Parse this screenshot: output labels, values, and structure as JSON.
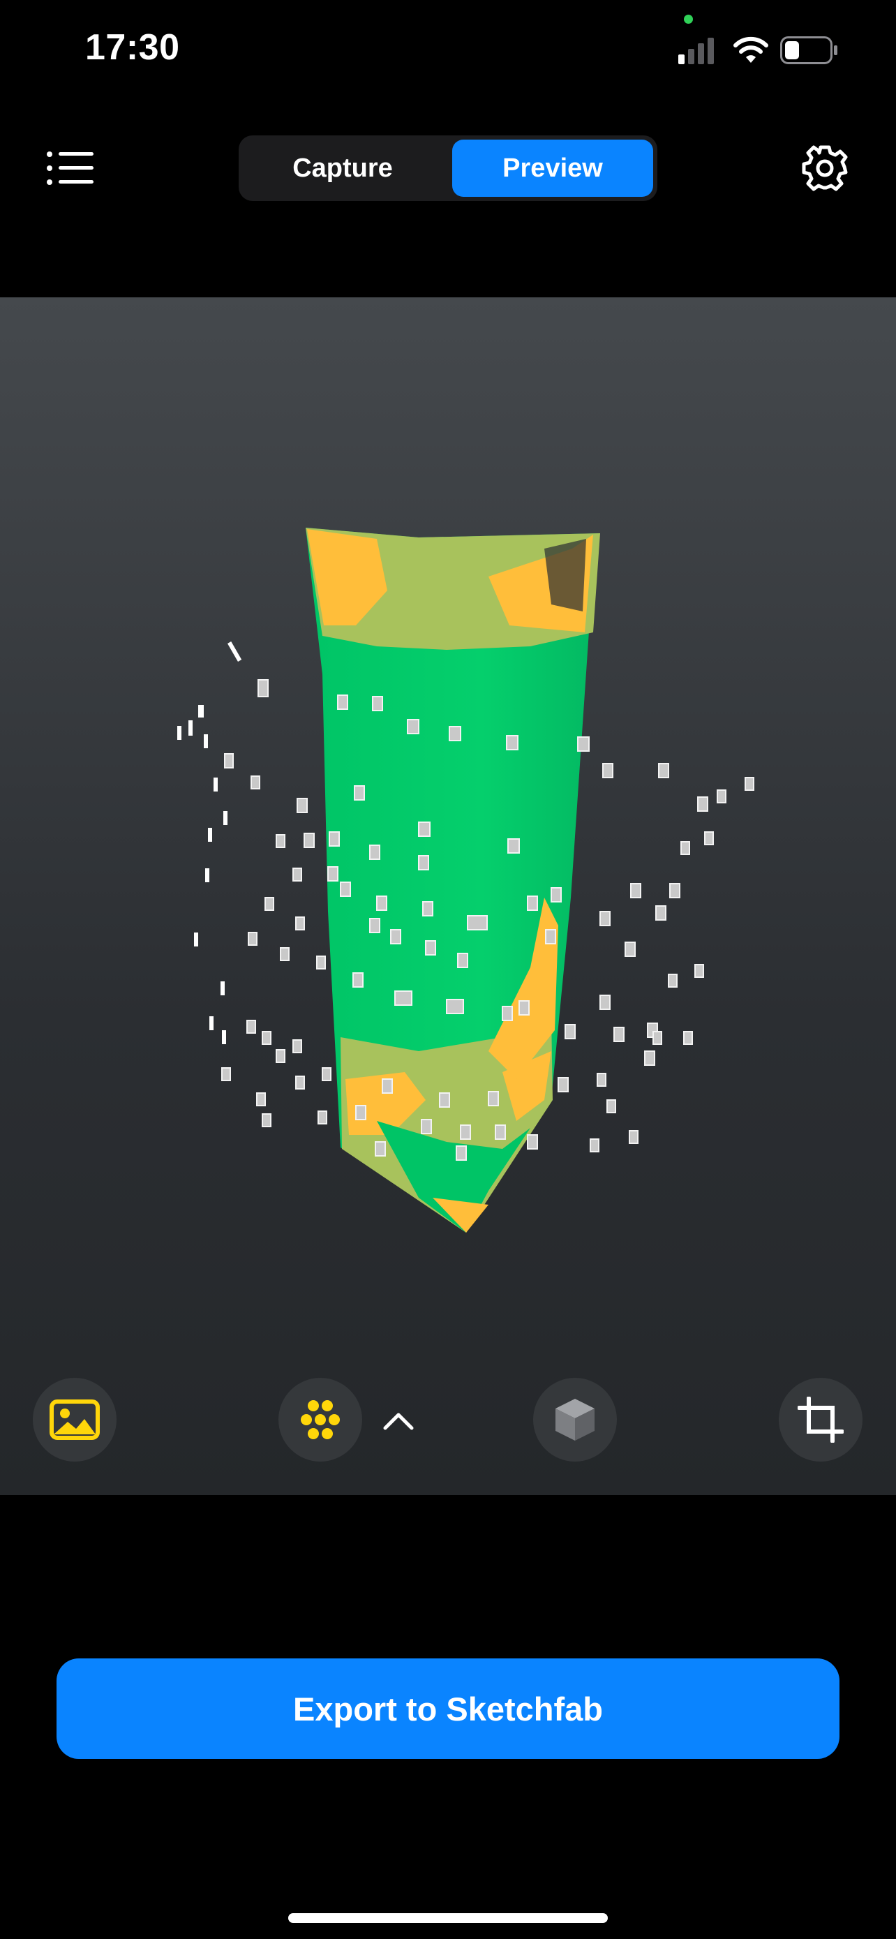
{
  "status_bar": {
    "time": "17:30"
  },
  "top_nav": {
    "tabs": [
      {
        "label": "Capture",
        "selected": false
      },
      {
        "label": "Preview",
        "selected": true
      }
    ],
    "menu_icon": "list-icon",
    "settings_icon": "gear-icon"
  },
  "viewer": {
    "toolbar": {
      "items": [
        "image-icon",
        "points-icon",
        "chevron-up-icon",
        "cube-icon",
        "crop-icon"
      ],
      "accent": "#ffd60a"
    },
    "model_colors": [
      "#00cc6a",
      "#ffbe3a",
      "#a8c25c"
    ]
  },
  "export": {
    "label": "Export to Sketchfab"
  },
  "colors": {
    "accent": "#0a84ff",
    "background": "#000000"
  }
}
